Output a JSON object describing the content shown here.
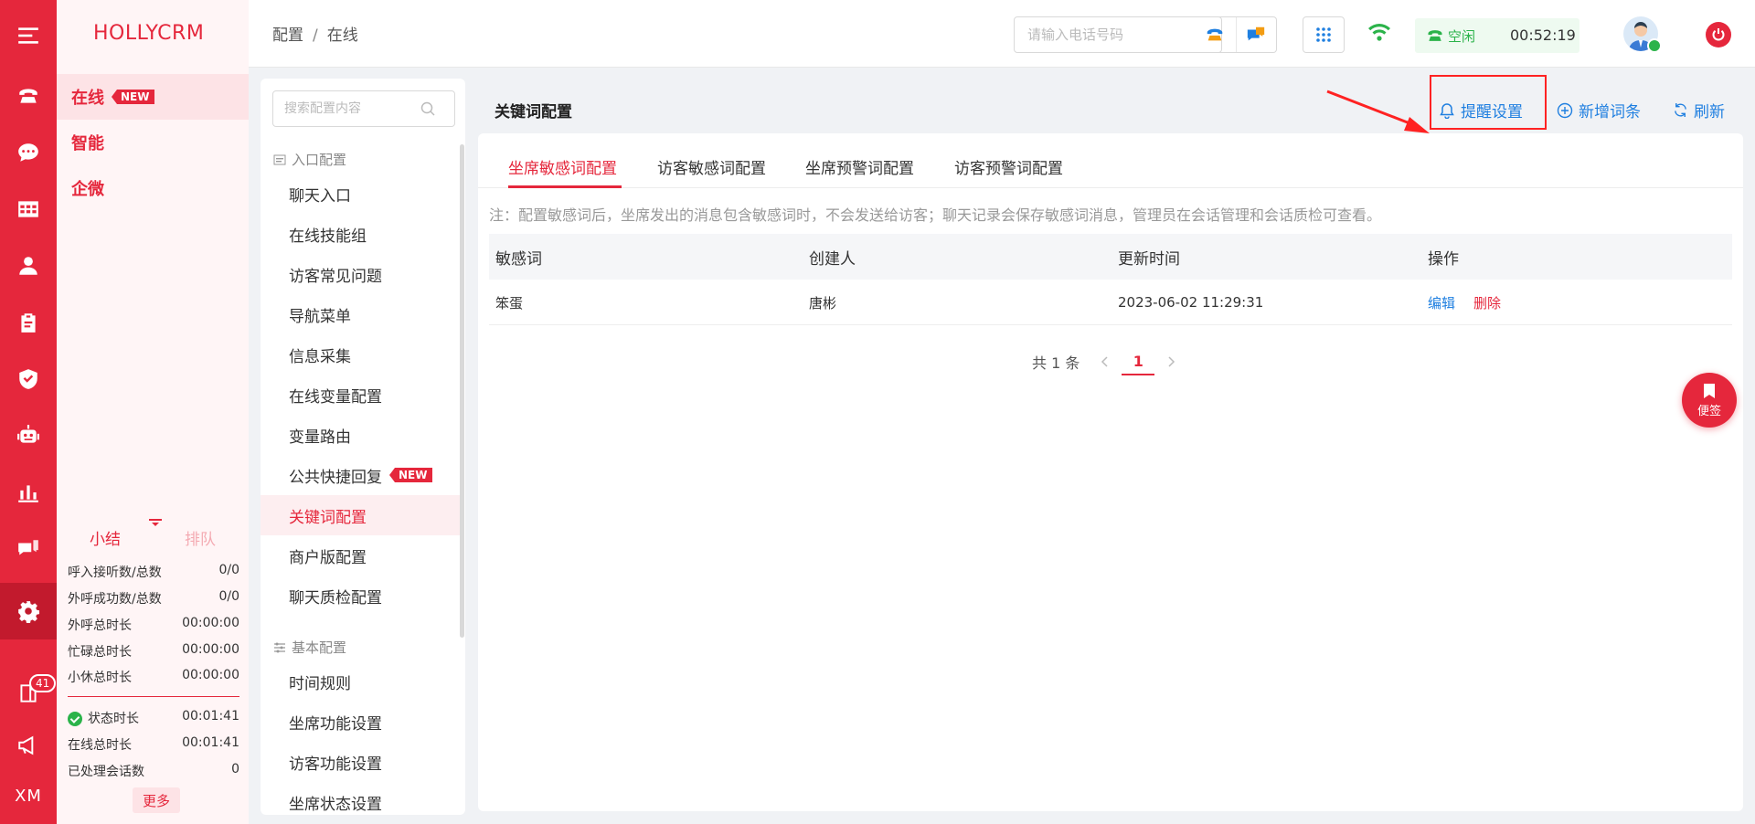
{
  "app": {
    "brand": "HOLLYCRM"
  },
  "rail": {
    "notification_count": "41",
    "footer": "XM"
  },
  "modules": [
    {
      "label": "在线",
      "tag": "NEW"
    },
    {
      "label": "智能"
    },
    {
      "label": "企微"
    }
  ],
  "summary": {
    "tab_summary": "小结",
    "tab_queue": "排队",
    "rows": [
      {
        "label": "呼入接听数/总数",
        "value": "0/0"
      },
      {
        "label": "外呼成功数/总数",
        "value": "0/0"
      },
      {
        "label": "外呼总时长",
        "value": "00:00:00"
      },
      {
        "label": "忙碌总时长",
        "value": "00:00:00"
      },
      {
        "label": "小休总时长",
        "value": "00:00:00"
      }
    ],
    "rows2": [
      {
        "label": "状态时长",
        "value": "00:01:41"
      },
      {
        "label": "在线总时长",
        "value": "00:01:41"
      },
      {
        "label": "已处理会话数",
        "value": "0"
      }
    ],
    "more": "更多"
  },
  "header": {
    "breadcrumb": [
      "配置",
      "在线"
    ],
    "breadcrumb_sep": "/",
    "phone_placeholder": "请输入电话号码",
    "status_label": "空闲",
    "status_time": "00:52:19"
  },
  "config_menu": {
    "search_placeholder": "搜索配置内容",
    "group1": "入口配置",
    "items1": [
      "聊天入口",
      "在线技能组",
      "访客常见问题",
      "导航菜单",
      "信息采集",
      "在线变量配置",
      "变量路由",
      "公共快捷回复",
      "关键词配置",
      "商户版配置",
      "聊天质检配置"
    ],
    "new_tag": "NEW",
    "group2": "基本配置",
    "items2": [
      "时间规则",
      "坐席功能设置",
      "访客功能设置",
      "坐席状态设置"
    ]
  },
  "main": {
    "title": "关键词配置",
    "actions": {
      "remind": "提醒设置",
      "add": "新增词条",
      "refresh": "刷新"
    },
    "tabs": [
      "坐席敏感词配置",
      "访客敏感词配置",
      "坐席预警词配置",
      "访客预警词配置"
    ],
    "note": "注：配置敏感词后，坐席发出的消息包含敏感词时，不会发送给访客；聊天记录会保存敏感词消息，管理员在会话管理和会话质检可查看。",
    "table": {
      "columns": [
        "敏感词",
        "创建人",
        "更新时间",
        "操作"
      ],
      "rows": [
        {
          "word": "笨蛋",
          "creator": "唐彬",
          "updated": "2023-06-02 11:29:31",
          "edit": "编辑",
          "delete": "删除"
        }
      ]
    },
    "pager": {
      "total": "共 1 条",
      "page": "1"
    }
  },
  "sticky_note": "便签",
  "colors": {
    "brand_red": "#e5273c",
    "link_blue": "#1f7fe0",
    "ok_green": "#2bb34a"
  }
}
